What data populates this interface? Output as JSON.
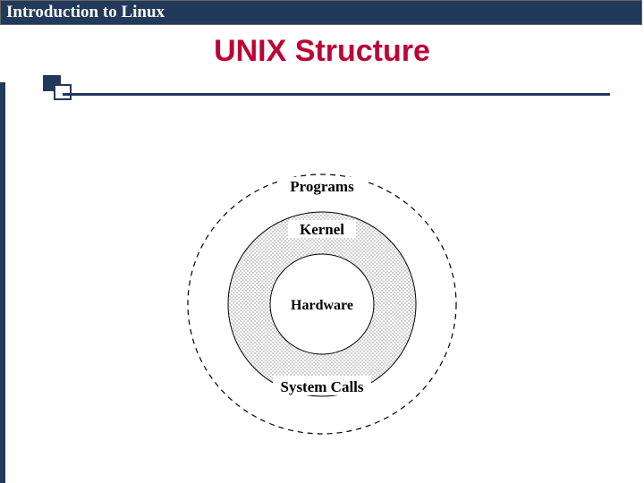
{
  "header": {
    "title": "Introduction to Linux"
  },
  "slide": {
    "title": "UNIX Structure"
  },
  "diagram": {
    "rings": {
      "outer": {
        "label": "Programs"
      },
      "middle": {
        "label": "Kernel"
      },
      "inner": {
        "label": "Hardware"
      },
      "bottom": {
        "label": "System Calls"
      }
    }
  },
  "colors": {
    "header_bg": "#21395a",
    "title_fg": "#bc0536",
    "dot_fill": "#b8b8b8"
  }
}
